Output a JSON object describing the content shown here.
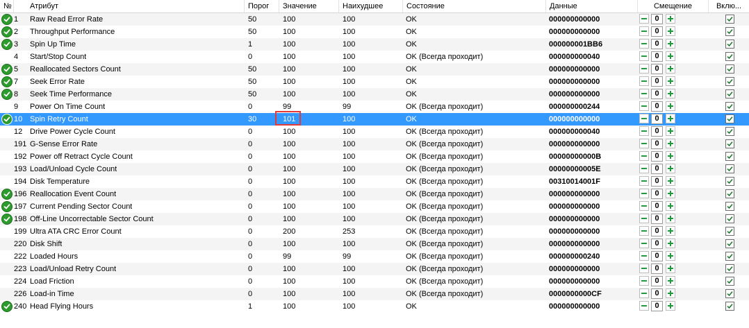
{
  "columns": {
    "num": "№",
    "attribute": "Атрибут",
    "threshold": "Порог",
    "value": "Значение",
    "worst": "Наихудшее",
    "state": "Состояние",
    "data": "Данные",
    "offset": "Смещение",
    "enabled": "Вклю..."
  },
  "colors": {
    "selected_row": "#3399ff",
    "status_ok_icon": "#2e9b2e",
    "offset_buttons": "#1f9a3a",
    "highlight": "#e53935"
  },
  "rows": [
    {
      "num": "1",
      "name": "Raw Read Error Rate",
      "threshold": "50",
      "value": "100",
      "worst": "100",
      "state": "OK",
      "data": "000000000000",
      "offset": "0",
      "icon": "ok-check-icon"
    },
    {
      "num": "2",
      "name": "Throughput Performance",
      "threshold": "50",
      "value": "100",
      "worst": "100",
      "state": "OK",
      "data": "000000000000",
      "offset": "0",
      "icon": "ok-check-icon"
    },
    {
      "num": "3",
      "name": "Spin Up Time",
      "threshold": "1",
      "value": "100",
      "worst": "100",
      "state": "OK",
      "data": "000000001BB6",
      "offset": "0",
      "icon": "ok-check-icon"
    },
    {
      "num": "4",
      "name": "Start/Stop Count",
      "threshold": "0",
      "value": "100",
      "worst": "100",
      "state": "OK (Всегда проходит)",
      "data": "000000000040",
      "offset": "0",
      "icon": ""
    },
    {
      "num": "5",
      "name": "Reallocated Sectors Count",
      "threshold": "50",
      "value": "100",
      "worst": "100",
      "state": "OK",
      "data": "000000000000",
      "offset": "0",
      "icon": "ok-check-icon"
    },
    {
      "num": "7",
      "name": "Seek Error Rate",
      "threshold": "50",
      "value": "100",
      "worst": "100",
      "state": "OK",
      "data": "000000000000",
      "offset": "0",
      "icon": "ok-check-icon"
    },
    {
      "num": "8",
      "name": "Seek Time Performance",
      "threshold": "50",
      "value": "100",
      "worst": "100",
      "state": "OK",
      "data": "000000000000",
      "offset": "0",
      "icon": "ok-check-icon"
    },
    {
      "num": "9",
      "name": "Power On Time Count",
      "threshold": "0",
      "value": "99",
      "worst": "99",
      "state": "OK (Всегда проходит)",
      "data": "000000000244",
      "offset": "0",
      "icon": ""
    },
    {
      "num": "10",
      "name": "Spin Retry Count",
      "threshold": "30",
      "value": "101",
      "worst": "100",
      "state": "OK",
      "data": "000000000000",
      "offset": "0",
      "icon": "ok-check-icon",
      "selected": true
    },
    {
      "num": "12",
      "name": "Drive Power Cycle Count",
      "threshold": "0",
      "value": "100",
      "worst": "100",
      "state": "OK (Всегда проходит)",
      "data": "000000000040",
      "offset": "0",
      "icon": ""
    },
    {
      "num": "191",
      "name": "G-Sense Error Rate",
      "threshold": "0",
      "value": "100",
      "worst": "100",
      "state": "OK (Всегда проходит)",
      "data": "000000000000",
      "offset": "0",
      "icon": ""
    },
    {
      "num": "192",
      "name": "Power off Retract Cycle Count",
      "threshold": "0",
      "value": "100",
      "worst": "100",
      "state": "OK (Всегда проходит)",
      "data": "00000000000B",
      "offset": "0",
      "icon": ""
    },
    {
      "num": "193",
      "name": "Load/Unload Cycle Count",
      "threshold": "0",
      "value": "100",
      "worst": "100",
      "state": "OK (Всегда проходит)",
      "data": "00000000005E",
      "offset": "0",
      "icon": ""
    },
    {
      "num": "194",
      "name": "Disk Temperature",
      "threshold": "0",
      "value": "100",
      "worst": "100",
      "state": "OK (Всегда проходит)",
      "data": "00310014001F",
      "offset": "0",
      "icon": ""
    },
    {
      "num": "196",
      "name": "Reallocation Event Count",
      "threshold": "0",
      "value": "100",
      "worst": "100",
      "state": "OK (Всегда проходит)",
      "data": "000000000000",
      "offset": "0",
      "icon": "ok-check-icon"
    },
    {
      "num": "197",
      "name": "Current Pending Sector Count",
      "threshold": "0",
      "value": "100",
      "worst": "100",
      "state": "OK (Всегда проходит)",
      "data": "000000000000",
      "offset": "0",
      "icon": "ok-check-icon"
    },
    {
      "num": "198",
      "name": "Off-Line Uncorrectable Sector Count",
      "threshold": "0",
      "value": "100",
      "worst": "100",
      "state": "OK (Всегда проходит)",
      "data": "000000000000",
      "offset": "0",
      "icon": "ok-check-icon"
    },
    {
      "num": "199",
      "name": "Ultra ATA CRC Error Count",
      "threshold": "0",
      "value": "200",
      "worst": "253",
      "state": "OK (Всегда проходит)",
      "data": "000000000000",
      "offset": "0",
      "icon": ""
    },
    {
      "num": "220",
      "name": "Disk Shift",
      "threshold": "0",
      "value": "100",
      "worst": "100",
      "state": "OK (Всегда проходит)",
      "data": "000000000000",
      "offset": "0",
      "icon": ""
    },
    {
      "num": "222",
      "name": "Loaded Hours",
      "threshold": "0",
      "value": "99",
      "worst": "99",
      "state": "OK (Всегда проходит)",
      "data": "000000000240",
      "offset": "0",
      "icon": ""
    },
    {
      "num": "223",
      "name": "Load/Unload Retry Count",
      "threshold": "0",
      "value": "100",
      "worst": "100",
      "state": "OK (Всегда проходит)",
      "data": "000000000000",
      "offset": "0",
      "icon": ""
    },
    {
      "num": "224",
      "name": "Load Friction",
      "threshold": "0",
      "value": "100",
      "worst": "100",
      "state": "OK (Всегда проходит)",
      "data": "000000000000",
      "offset": "0",
      "icon": ""
    },
    {
      "num": "226",
      "name": "Load-in Time",
      "threshold": "0",
      "value": "100",
      "worst": "100",
      "state": "OK (Всегда проходит)",
      "data": "0000000000CF",
      "offset": "0",
      "icon": ""
    },
    {
      "num": "240",
      "name": "Head Flying Hours",
      "threshold": "1",
      "value": "100",
      "worst": "100",
      "state": "OK",
      "data": "000000000000",
      "offset": "0",
      "icon": "ok-check-icon"
    }
  ]
}
